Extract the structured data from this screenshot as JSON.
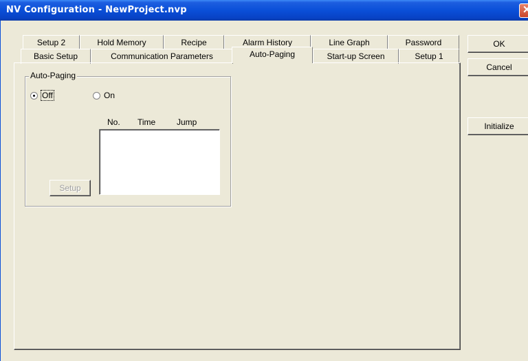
{
  "window": {
    "title": "NV Configuration - NewProject.nvp",
    "close_glyph": "✕"
  },
  "tabs_row1": [
    "Setup 2",
    "Hold Memory",
    "Recipe",
    "Alarm History",
    "Line Graph",
    "Password"
  ],
  "tabs_row2": [
    "Basic Setup",
    "Communication Parameters",
    "Auto-Paging",
    "Start-up Screen",
    "Setup 1"
  ],
  "active_tab": "Auto-Paging",
  "autopaging": {
    "group_label": "Auto-Paging",
    "radio_off": "Off",
    "radio_on": "On",
    "selected": "Off",
    "columns": [
      "No.",
      "Time",
      "Jump"
    ],
    "setup_button": "Setup"
  },
  "buttons": {
    "ok": "OK",
    "cancel": "Cancel",
    "initialize": "Initialize"
  },
  "colors": {
    "title_bar": "#0a4fd8",
    "dialog_bg": "#ece9d8"
  }
}
